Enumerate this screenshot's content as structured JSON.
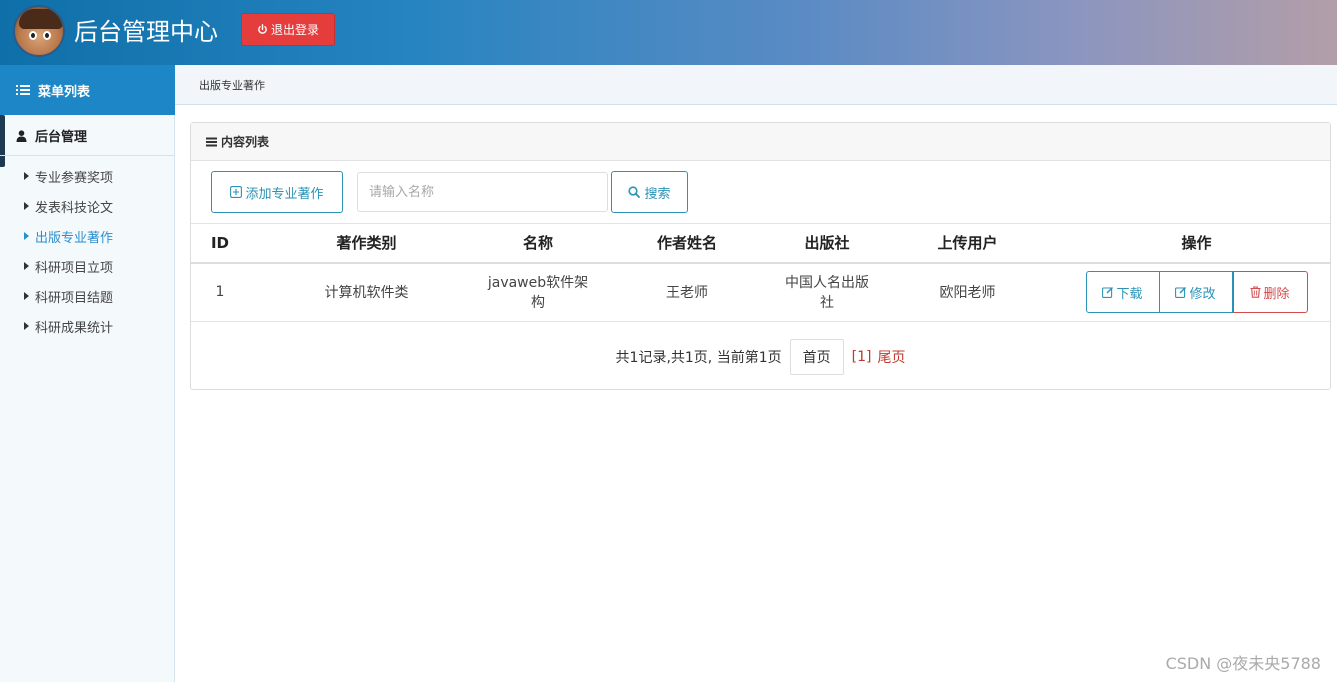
{
  "header": {
    "title": "后台管理中心",
    "logout_label": "退出登录"
  },
  "sidebar": {
    "menu_header": "菜单列表",
    "group_title": "后台管理",
    "items": [
      {
        "label": "专业参赛奖项"
      },
      {
        "label": "发表科技论文"
      },
      {
        "label": "出版专业著作",
        "active": true
      },
      {
        "label": "科研项目立项"
      },
      {
        "label": "科研项目结题"
      },
      {
        "label": "科研成果统计"
      }
    ]
  },
  "breadcrumb": {
    "current": "出版专业著作"
  },
  "panel": {
    "title": "内容列表",
    "add_button": "添加专业著作",
    "search_placeholder": "请输入名称",
    "search_button": "搜索"
  },
  "table": {
    "headers": [
      "ID",
      "著作类别",
      "名称",
      "作者姓名",
      "出版社",
      "上传用户",
      "操作"
    ],
    "rows": [
      {
        "id": "1",
        "type": "计算机软件类",
        "name": "javaweb软件架构",
        "author": "王老师",
        "publisher": "中国人名出版社",
        "uploader": "欧阳老师"
      }
    ],
    "actions": {
      "download": "下载",
      "edit": "修改",
      "delete": "删除"
    }
  },
  "pager": {
    "summary": "共1记录,共1页, 当前第1页",
    "first": "首页",
    "current": "[1]",
    "last": "尾页"
  },
  "watermark": "CSDN @夜未央5788",
  "colors": {
    "primary": "#1d86c6",
    "danger": "#e53c3c",
    "link": "#2a93b6"
  }
}
